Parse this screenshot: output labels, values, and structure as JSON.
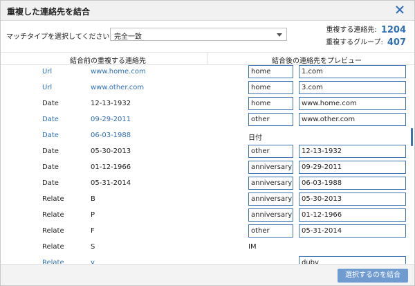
{
  "dialog": {
    "title": "重複した連絡先を結合"
  },
  "match": {
    "label": "マッチタイプを選択してください：",
    "selected": "完全一致"
  },
  "stats": {
    "dup_contacts_label": "重複する連絡先:",
    "dup_contacts_value": "1204",
    "dup_groups_label": "重複するグループ:",
    "dup_groups_value": "407"
  },
  "columns": {
    "left": "結合前の重複する連絡先",
    "right": "結合後の連絡先をプレビュー"
  },
  "rows": [
    {
      "type": "Url",
      "value": "www.home.com",
      "color": "blue",
      "preview_type": "home",
      "preview_value": "1.com",
      "mode": "boxes"
    },
    {
      "type": "Url",
      "value": "www.other.com",
      "color": "blue",
      "preview_type": "home",
      "preview_value": "3.com",
      "mode": "boxes"
    },
    {
      "type": "Date",
      "value": "12-13-1932",
      "color": "black",
      "preview_type": "home",
      "preview_value": "www.home.com",
      "mode": "boxes"
    },
    {
      "type": "Date",
      "value": "09-29-2011",
      "color": "blue",
      "preview_type": "other",
      "preview_value": "www.other.com",
      "mode": "boxes"
    },
    {
      "type": "Date",
      "value": "06-03-1988",
      "color": "blue",
      "preview_type": "日付",
      "preview_value": "",
      "mode": "plain"
    },
    {
      "type": "Date",
      "value": "05-30-2013",
      "color": "black",
      "preview_type": "other",
      "preview_value": "12-13-1932",
      "mode": "boxes"
    },
    {
      "type": "Date",
      "value": "01-12-1966",
      "color": "black",
      "preview_type": "anniversary",
      "preview_value": "09-29-2011",
      "mode": "boxes"
    },
    {
      "type": "Date",
      "value": "05-31-2014",
      "color": "black",
      "preview_type": "anniversary",
      "preview_value": "06-03-1988",
      "mode": "boxes"
    },
    {
      "type": "Relate",
      "value": "B",
      "color": "black",
      "preview_type": "anniversary",
      "preview_value": "05-30-2013",
      "mode": "boxes"
    },
    {
      "type": "Relate",
      "value": "P",
      "color": "black",
      "preview_type": "anniversary",
      "preview_value": "01-12-1966",
      "mode": "boxes"
    },
    {
      "type": "Relate",
      "value": "F",
      "color": "black",
      "preview_type": "other",
      "preview_value": "05-31-2014",
      "mode": "boxes"
    },
    {
      "type": "Relate",
      "value": "S",
      "color": "black",
      "preview_type": "IM",
      "preview_value": "",
      "mode": "plain"
    },
    {
      "type": "Relate",
      "value": "y",
      "color": "blue",
      "preview_type": "",
      "preview_value": "dubv",
      "mode": "valueonly"
    }
  ],
  "footer": {
    "merge_button": "選択するのを結合"
  },
  "icons": {
    "close": "close-icon",
    "dropdown": "chevron-down-icon"
  },
  "colors": {
    "accent": "#2e6fb5",
    "box_border": "#3a73b3",
    "button": "#6f9bd1"
  }
}
